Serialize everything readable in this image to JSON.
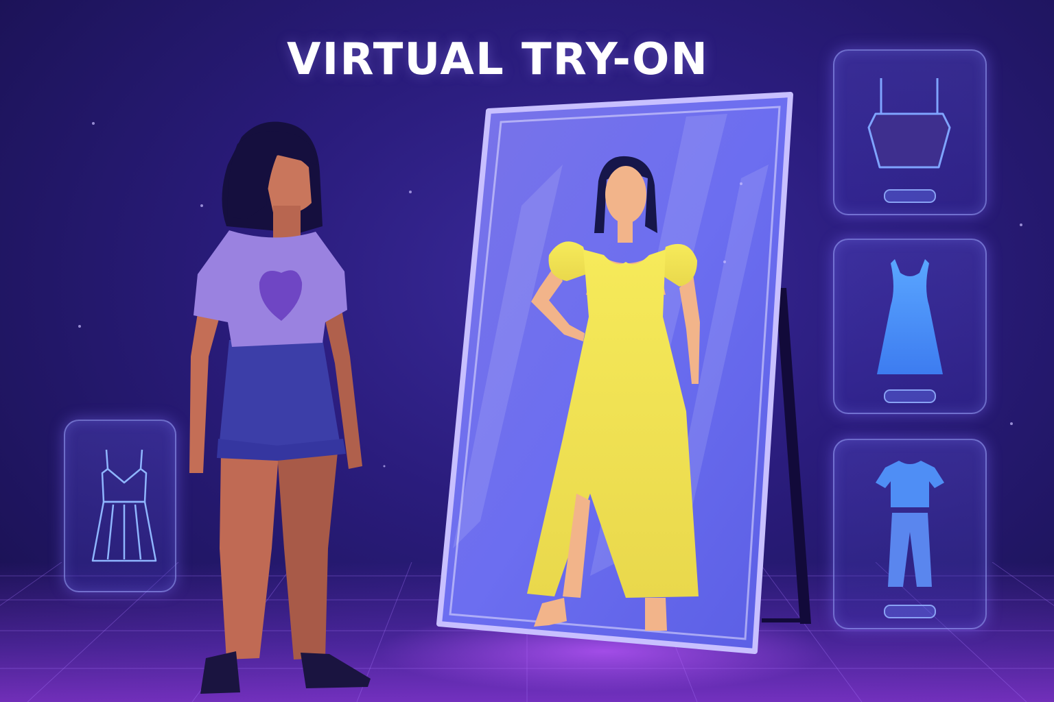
{
  "title": "VIRTUAL TRY-ON",
  "colors": {
    "background": "#261a72",
    "accent": "#8a7cff",
    "dress": "#f2e256",
    "glow": "#b07bff"
  },
  "options": [
    {
      "icon": "camisole-top-icon"
    },
    {
      "icon": "tank-dress-icon"
    },
    {
      "icon": "tshirt-pants-outfit-icon"
    }
  ],
  "left_card": {
    "icon": "slip-dress-outline-icon"
  }
}
